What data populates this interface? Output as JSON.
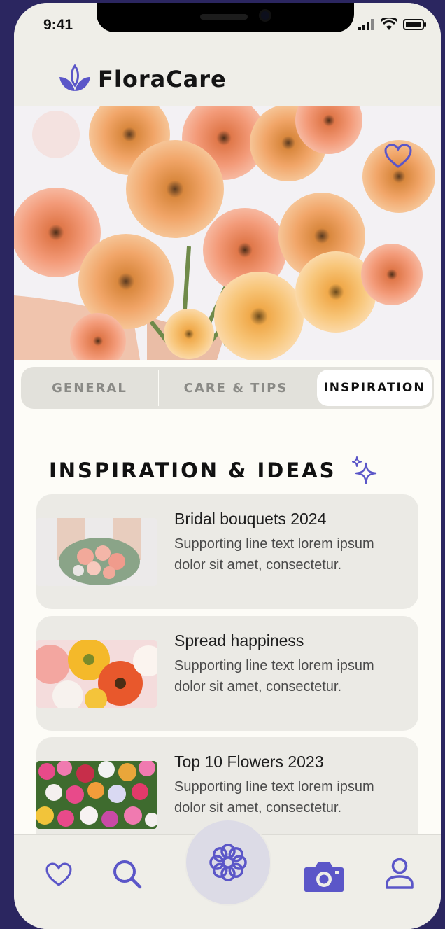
{
  "status_bar": {
    "time": "9:41"
  },
  "app": {
    "name": "FloraCare"
  },
  "tabs": [
    {
      "label": "GENERAL"
    },
    {
      "label": "CARE & TIPS"
    },
    {
      "label": "INSPIRATION"
    }
  ],
  "active_tab": "INSPIRATION",
  "section": {
    "title": "INSPIRATION & IDEAS"
  },
  "cards": [
    {
      "title": "Bridal bouquets 2024",
      "subtitle": "Supporting line text lorem ipsum dolor sit amet, consectetur."
    },
    {
      "title": "Spread happiness",
      "subtitle": "Supporting line text lorem ipsum dolor sit amet, consectetur."
    },
    {
      "title": "Top 10 Flowers 2023",
      "subtitle": "Supporting line text lorem ipsum dolor sit amet, consectetur."
    }
  ],
  "nav": [
    {
      "icon": "heart-icon"
    },
    {
      "icon": "search-icon"
    },
    {
      "icon": "flower-icon"
    },
    {
      "icon": "camera-icon"
    },
    {
      "icon": "profile-icon"
    }
  ],
  "colors": {
    "accent": "#5b56c8",
    "background": "#fdfcf7",
    "surface": "#ebeae5",
    "frame": "#2b2660"
  }
}
